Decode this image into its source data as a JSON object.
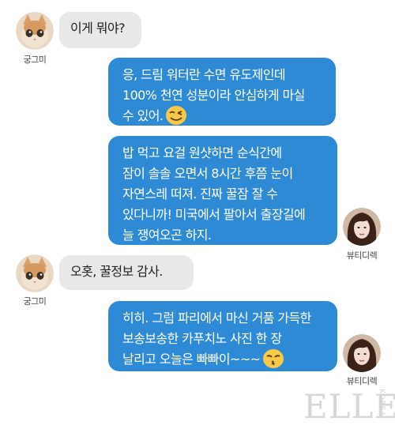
{
  "conversation": {
    "messages": [
      {
        "side": "left",
        "sender": "궁그미",
        "lines": [
          "이게 뭐야?"
        ]
      },
      {
        "side": "right",
        "sender": "",
        "lines": [
          "응, 드림 워터란 수면 유도제인데",
          "100% 천연 성분이라 안심하게 마실",
          "수 있어."
        ]
      },
      {
        "side": "right",
        "sender": "뷰티디렉",
        "lines": [
          "밥 먹고 요걸 원샷하면 순식간에",
          "잠이 솔솔 오면서 8시간 후쯤 눈이",
          "자연스레 떠져. 진짜 꿀잠 잘 수",
          "있다니까! 미국에서 팔아서 출장길에",
          "늘 쟁여오곤 하지."
        ]
      },
      {
        "side": "left",
        "sender": "궁그미",
        "lines": [
          "오홋, 꿀정보 감사."
        ]
      },
      {
        "side": "right",
        "sender": "뷰티디렉",
        "lines": [
          "히히. 그럼 파리에서 마신 거품 가득한",
          "보송보송한 카푸치노 사진 한 장",
          "날리고 오늘은 빠빠이~~~"
        ]
      }
    ]
  },
  "icons": {
    "sender_left_avatar": "kitten-avatar",
    "sender_right_avatar": "woman-portrait-avatar",
    "emoji_1": "winking-smile-emoji",
    "emoji_2": "kissing-face-emoji"
  },
  "colors": {
    "outgoing_bubble": "#2f8ad6",
    "incoming_bubble": "#e8e8e8"
  },
  "watermark": {
    "brand": "ELLE",
    "sub": "KOREA"
  }
}
